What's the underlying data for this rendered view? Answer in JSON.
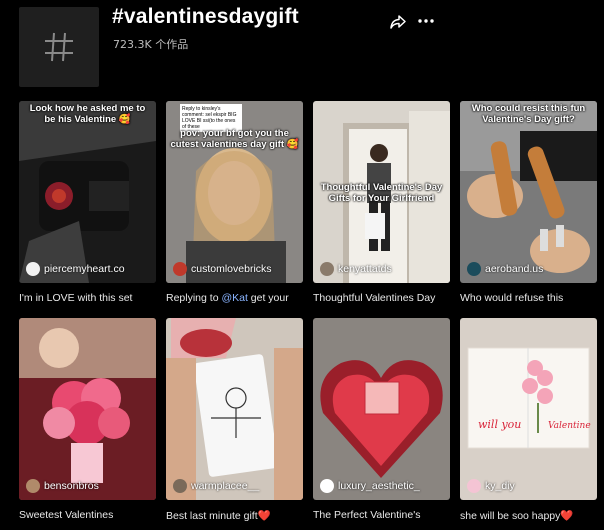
{
  "header": {
    "title": "#valentinesdaygift",
    "video_count": "723.3K 个作品",
    "tag_icon": "hashtag-icon",
    "share_icon": "share-icon",
    "more_icon": "more-icon"
  },
  "videos": [
    {
      "overlay": "Look how he asked me to be his Valentine 🥰",
      "author": "piercemyheart.co",
      "caption": "I'm in LOVE with this set"
    },
    {
      "overlay_small": "Reply to kinsley's comment: sel ekspir BIG LOVE BI ssi(to the ones of these",
      "overlay": "pov: your bf got you the cutest valentines day gift 🥰",
      "author": "customlovebricks",
      "caption_prefix": "Replying to ",
      "caption_mention": "@Kat",
      "caption_suffix": " get your"
    },
    {
      "overlay": "Thoughtful Valentine's Day Gifts for Your Girlfriend",
      "author": "kenyattatds",
      "caption": "Thoughtful Valentines Day"
    },
    {
      "overlay": "Who could resist this fun Valentine's Day gift?",
      "author": "aeroband.us",
      "caption": "Who would refuse this"
    },
    {
      "overlay": "",
      "author": "bensonbros",
      "caption": "Sweetest Valentines"
    },
    {
      "overlay": "",
      "author": "warmplacee__",
      "caption": "Best last minute gift❤️"
    },
    {
      "overlay": "",
      "author": "luxury_aesthetic_",
      "caption": "The Perfect Valentine's"
    },
    {
      "overlay": "",
      "author": "ky_diy",
      "caption": "she will be soo happy❤️"
    }
  ]
}
